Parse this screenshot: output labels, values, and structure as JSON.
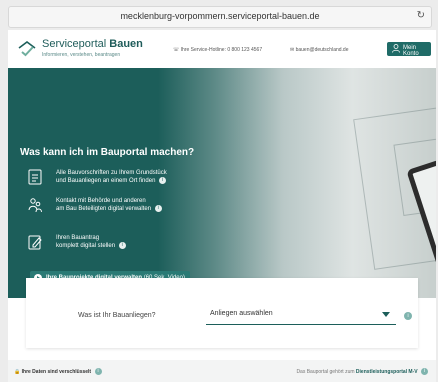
{
  "browser": {
    "url": "mecklenburg-vorpommern.serviceportal-bauen.de"
  },
  "header": {
    "brand_prefix": "Serviceportal",
    "brand_bold": "Bauen",
    "tagline": "Informieren, verstehen, beantragen",
    "hotline": "Ihre Service-Hotline: 0 800 123 4567",
    "email": "bauen@deutschland.de",
    "account_label": "Mein Konto"
  },
  "hero": {
    "title": "Was kann ich im Bauportal machen?",
    "features": [
      {
        "line1": "Alle Bauvorschriften zu Ihrem Grundstück",
        "line2": "und Bauanliegen an einem Ort finden",
        "icon": "document-icon"
      },
      {
        "line1": "Kontakt mit Behörde und anderen",
        "line2": "am Bau Beteiligten digital verwalten",
        "icon": "people-icon"
      },
      {
        "line1": "Ihren Bauantrag",
        "line2": "komplett digital stellen",
        "icon": "edit-icon"
      }
    ],
    "video_label_bold": "Ihre Bauprojekte digital verwalten",
    "video_label_rest": "(60 Sek. Video)"
  },
  "question": {
    "label": "Was ist Ihr Bauanliegen?",
    "select_value": "Anliegen auswählen"
  },
  "footer": {
    "secure_label": "Ihre Daten sind verschlüsselt",
    "right_text": "Das Bauportal gehört zum",
    "right_link": "Dienstleistungsportal M-V"
  },
  "colors": {
    "brand": "#1c5e5a",
    "accent": "#2a7a75"
  }
}
